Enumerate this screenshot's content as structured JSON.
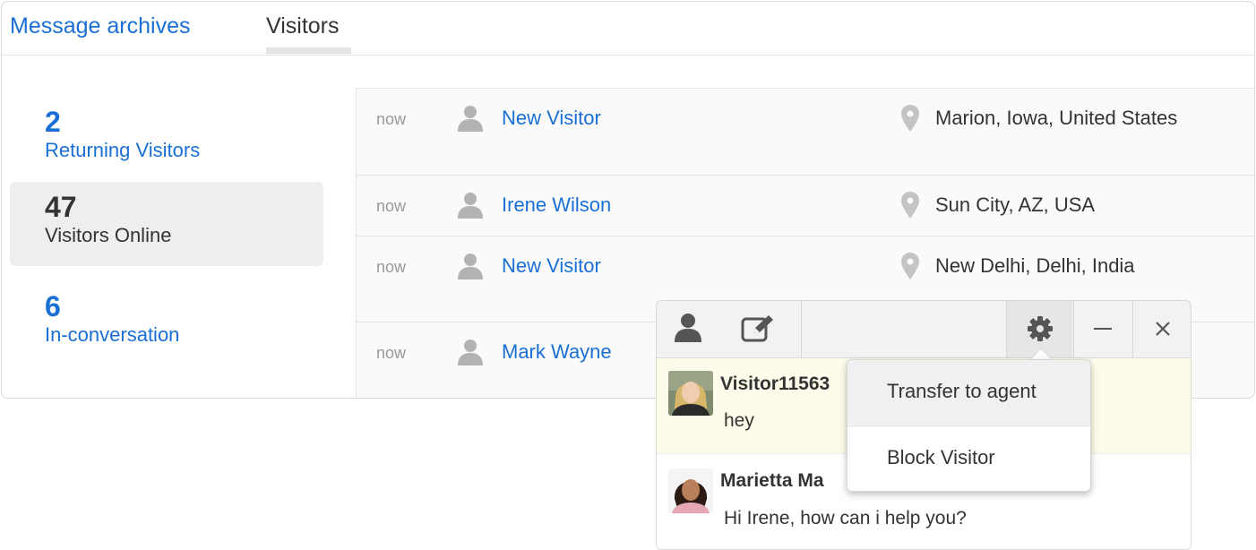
{
  "tabs": {
    "archives": "Message archives",
    "visitors": "Visitors"
  },
  "stats": [
    {
      "number": "2",
      "label": "Returning Visitors"
    },
    {
      "number": "47",
      "label": "Visitors Online"
    },
    {
      "number": "6",
      "label": "In-conversation"
    }
  ],
  "visitors": [
    {
      "time": "now",
      "name": "New Visitor",
      "location": "Marion, Iowa, United States"
    },
    {
      "time": "now",
      "name": "Irene Wilson",
      "location": "Sun City, AZ, USA"
    },
    {
      "time": "now",
      "name": "New Visitor",
      "location": "New Delhi, Delhi, India"
    },
    {
      "time": "now",
      "name": "Mark Wayne",
      "location": ""
    }
  ],
  "chat": {
    "messages": [
      {
        "sender": "Visitor11563",
        "text": "hey"
      },
      {
        "sender": "Marietta Ma",
        "text": "Hi Irene, how can i help you?"
      }
    ]
  },
  "menu": {
    "transfer": "Transfer to agent",
    "block": "Block Visitor"
  },
  "colors": {
    "link": "#1a6fd6",
    "active_stat_bg": "#eeeeee",
    "visitor_message_bg": "#fdfbea"
  }
}
